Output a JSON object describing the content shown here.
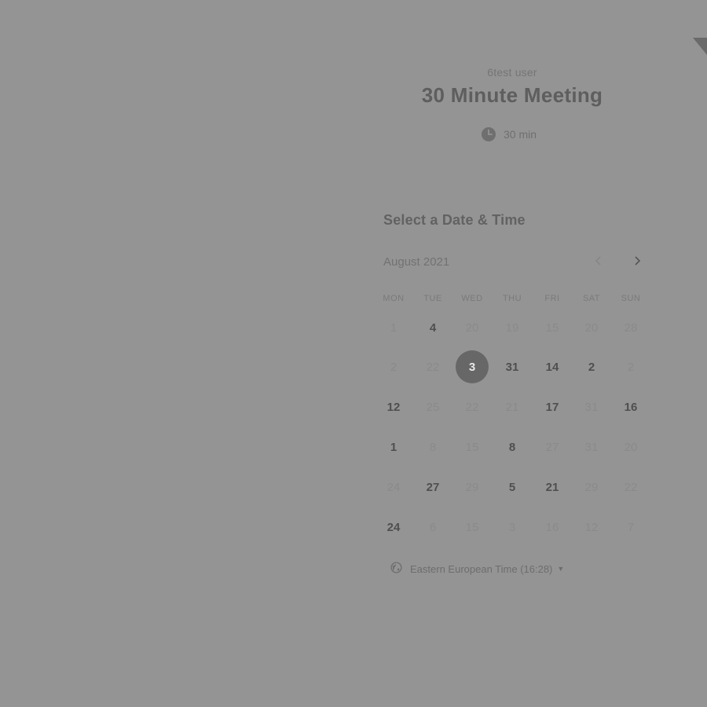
{
  "host_name": "6test user",
  "event": {
    "title": "30 Minute Meeting",
    "duration": "30 min"
  },
  "picker": {
    "title": "Select a Date & Time",
    "month": "August 2021",
    "weekdays": [
      "MON",
      "TUE",
      "WED",
      "THU",
      "FRI",
      "SAT",
      "SUN"
    ],
    "weeks": [
      [
        {
          "d": "1",
          "s": "unavailable"
        },
        {
          "d": "4",
          "s": "available"
        },
        {
          "d": "20",
          "s": "unavailable"
        },
        {
          "d": "19",
          "s": "unavailable"
        },
        {
          "d": "15",
          "s": "unavailable"
        },
        {
          "d": "20",
          "s": "unavailable"
        },
        {
          "d": "28",
          "s": "unavailable"
        }
      ],
      [
        {
          "d": "2",
          "s": "unavailable"
        },
        {
          "d": "22",
          "s": "unavailable"
        },
        {
          "d": "3",
          "s": "selected"
        },
        {
          "d": "31",
          "s": "available"
        },
        {
          "d": "14",
          "s": "available"
        },
        {
          "d": "2",
          "s": "available"
        },
        {
          "d": "2",
          "s": "unavailable"
        }
      ],
      [
        {
          "d": "12",
          "s": "available"
        },
        {
          "d": "25",
          "s": "unavailable"
        },
        {
          "d": "22",
          "s": "unavailable"
        },
        {
          "d": "21",
          "s": "unavailable"
        },
        {
          "d": "17",
          "s": "available"
        },
        {
          "d": "31",
          "s": "unavailable"
        },
        {
          "d": "16",
          "s": "available"
        }
      ],
      [
        {
          "d": "1",
          "s": "available"
        },
        {
          "d": "8",
          "s": "unavailable"
        },
        {
          "d": "15",
          "s": "unavailable"
        },
        {
          "d": "8",
          "s": "available"
        },
        {
          "d": "27",
          "s": "unavailable"
        },
        {
          "d": "31",
          "s": "unavailable"
        },
        {
          "d": "20",
          "s": "unavailable"
        }
      ],
      [
        {
          "d": "24",
          "s": "unavailable"
        },
        {
          "d": "27",
          "s": "available"
        },
        {
          "d": "29",
          "s": "unavailable"
        },
        {
          "d": "5",
          "s": "available"
        },
        {
          "d": "21",
          "s": "available"
        },
        {
          "d": "29",
          "s": "unavailable"
        },
        {
          "d": "22",
          "s": "unavailable"
        }
      ],
      [
        {
          "d": "24",
          "s": "available"
        },
        {
          "d": "6",
          "s": "unavailable"
        },
        {
          "d": "15",
          "s": "unavailable"
        },
        {
          "d": "3",
          "s": "unavailable"
        },
        {
          "d": "16",
          "s": "unavailable"
        },
        {
          "d": "12",
          "s": "unavailable"
        },
        {
          "d": "7",
          "s": "unavailable"
        }
      ]
    ]
  },
  "timezone": {
    "label": "Eastern European Time (16:28)"
  },
  "icons": {
    "duration": "clock-icon",
    "prev": "chevron-left-icon",
    "next": "chevron-right-icon",
    "timezone": "globe-icon",
    "dropdown": "caret-down-icon"
  },
  "colors": {
    "background": "#949494",
    "selected_day": "#676767"
  }
}
